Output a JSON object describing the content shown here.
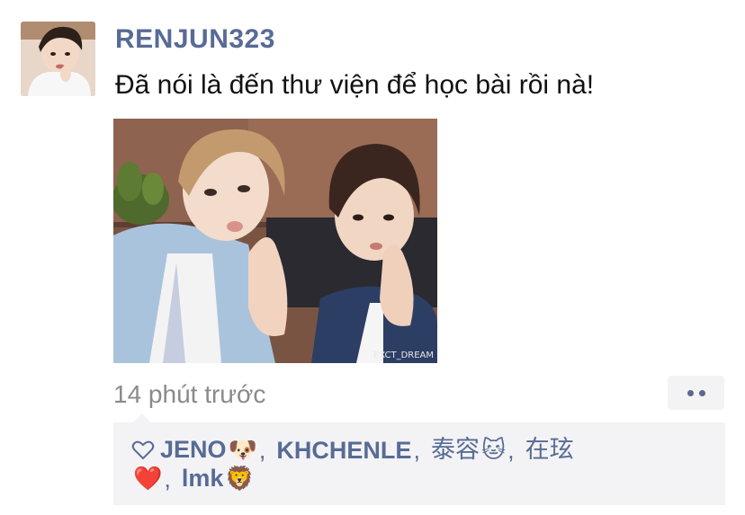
{
  "post": {
    "username": "RENJUN323",
    "text": "Đã nói là đến thư viện để học bài rồi nà!",
    "photo_watermark": "EXCT_DREAM",
    "timestamp": "14 phút trước"
  },
  "likes": {
    "icon": "heart-outline-icon",
    "line1": [
      {
        "name": "JENO",
        "emoji": "🐶"
      },
      {
        "name": "KHCHENLE",
        "emoji": ""
      },
      {
        "name": "泰容",
        "emoji": "🐱"
      },
      {
        "name": "在玹",
        "emoji": ""
      }
    ],
    "line2": [
      {
        "name": "",
        "emoji": "❤️"
      },
      {
        "name": "lmk",
        "emoji": "🦁"
      }
    ],
    "separator": ","
  },
  "colors": {
    "link": "#576b95",
    "timestamp": "#8a8a8a",
    "panel": "#f3f3f5"
  }
}
